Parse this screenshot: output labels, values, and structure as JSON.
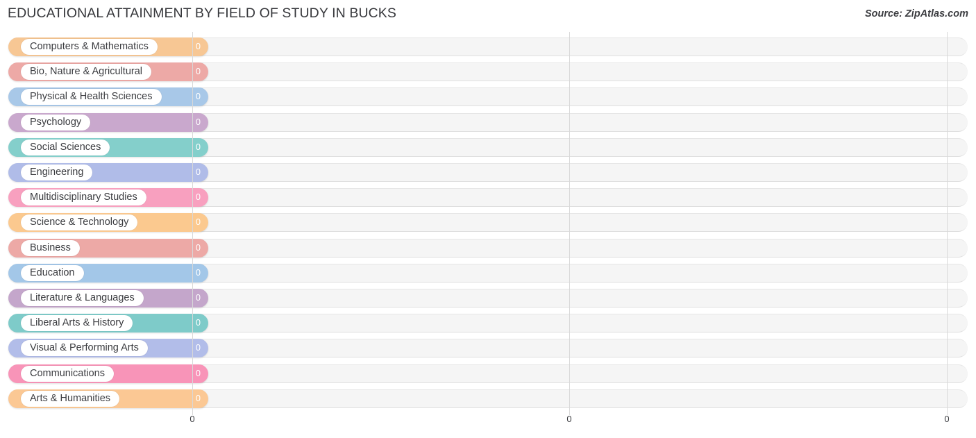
{
  "header": {
    "title": "EDUCATIONAL ATTAINMENT BY FIELD OF STUDY IN BUCKS",
    "source": "Source: ZipAtlas.com"
  },
  "chart_data": {
    "type": "bar",
    "orientation": "horizontal",
    "title": "EDUCATIONAL ATTAINMENT BY FIELD OF STUDY IN BUCKS",
    "xlabel": "",
    "ylabel": "",
    "xlim": [
      0,
      0
    ],
    "xticks": [
      "0",
      "0",
      "0"
    ],
    "grid": true,
    "legend": "none",
    "categories": [
      "Computers & Mathematics",
      "Bio, Nature & Agricultural",
      "Physical & Health Sciences",
      "Psychology",
      "Social Sciences",
      "Engineering",
      "Multidisciplinary Studies",
      "Science & Technology",
      "Business",
      "Education",
      "Literature & Languages",
      "Liberal Arts & History",
      "Visual & Performing Arts",
      "Communications",
      "Arts & Humanities"
    ],
    "values": [
      0,
      0,
      0,
      0,
      0,
      0,
      0,
      0,
      0,
      0,
      0,
      0,
      0,
      0,
      0
    ],
    "value_labels": [
      "0",
      "0",
      "0",
      "0",
      "0",
      "0",
      "0",
      "0",
      "0",
      "0",
      "0",
      "0",
      "0",
      "0",
      "0"
    ],
    "colors": [
      "#f7c794",
      "#eda9a6",
      "#a8c8e8",
      "#c9a8cd",
      "#84cfcb",
      "#b0bce8",
      "#f8a0bf",
      "#fbc98f",
      "#eda9a6",
      "#a3c7e8",
      "#c4a6cb",
      "#7ecbc9",
      "#b2bde9",
      "#f894b8",
      "#fbc894"
    ]
  }
}
